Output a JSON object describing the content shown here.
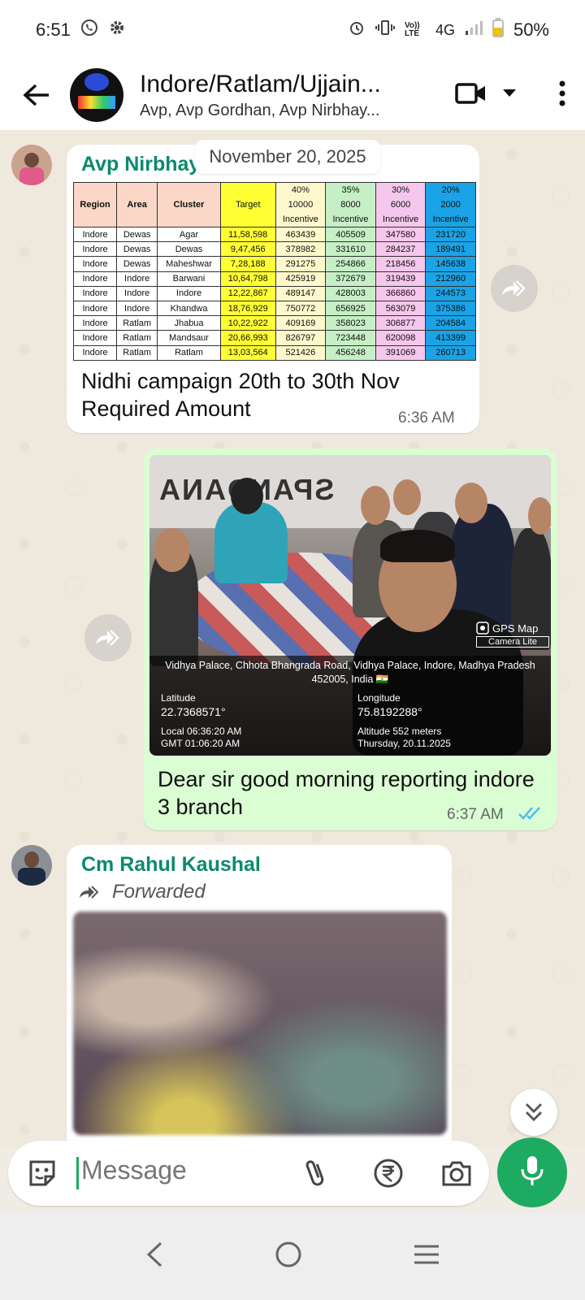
{
  "status_bar": {
    "time": "6:51",
    "network": "4G",
    "battery": "50%",
    "volte": "Vo)) LTE"
  },
  "header": {
    "title": "Indore/Ratlam/Ujjain...",
    "members": "Avp, Avp Gordhan, Avp Nirbhay..."
  },
  "date_chip": "November 20, 2025",
  "messages": {
    "m1": {
      "sender": "Avp Nirbhay Sir",
      "table": {
        "headers": [
          "Region",
          "Area",
          "Cluster",
          "Target",
          "40%\n10000\nIncentive",
          "35%\n8000\nIncentive",
          "30%\n6000\nIncentive",
          "20%\n2000\nIncentive"
        ],
        "rows": [
          [
            "Indore",
            "Dewas",
            "Agar",
            "11,58,598",
            "463439",
            "405509",
            "347580",
            "231720"
          ],
          [
            "Indore",
            "Dewas",
            "Dewas",
            "9,47,456",
            "378982",
            "331610",
            "284237",
            "189491"
          ],
          [
            "Indore",
            "Dewas",
            "Maheshwar",
            "7,28,188",
            "291275",
            "254866",
            "218456",
            "145638"
          ],
          [
            "Indore",
            "Indore",
            "Barwani",
            "10,64,798",
            "425919",
            "372679",
            "319439",
            "212960"
          ],
          [
            "Indore",
            "Indore",
            "Indore",
            "12,22,867",
            "489147",
            "428003",
            "366860",
            "244573"
          ],
          [
            "Indore",
            "Indore",
            "Khandwa",
            "18,76,929",
            "750772",
            "656925",
            "563079",
            "375386"
          ],
          [
            "Indore",
            "Ratlam",
            "Jhabua",
            "10,22,922",
            "409169",
            "358023",
            "306877",
            "204584"
          ],
          [
            "Indore",
            "Ratlam",
            "Mandsaur",
            "20,66,993",
            "826797",
            "723448",
            "620098",
            "413399"
          ],
          [
            "Indore",
            "Ratlam",
            "Ratlam",
            "13,03,564",
            "521426",
            "456248",
            "391069",
            "260713"
          ]
        ]
      },
      "text": "Nidhi campaign 20th to 30th Nov Required Amount",
      "time": "6:36 AM"
    },
    "m2": {
      "photo_wall_text": "SPANDANA",
      "gps_brand": "GPS Map",
      "gps_brand_sub": "Camera Lite",
      "address": "Vidhya Palace, Chhota Bhangrada Road, Vidhya Palace, Indore, Madhya Pradesh 452005, India 🇮🇳",
      "latitude_label": "Latitude",
      "latitude": "22.7368571°",
      "longitude_label": "Longitude",
      "longitude": "75.8192288°",
      "local_time": "Local 06:36:20 AM",
      "gmt_time": "GMT 01:06:20 AM",
      "altitude": "Altitude 552 meters",
      "day_date": "Thursday, 20.11.2025",
      "text": "Dear sir good morning reporting indore 3 branch",
      "time": "6:37 AM"
    },
    "m3": {
      "sender": "Cm Rahul Kaushal",
      "forwarded": "Forwarded"
    }
  },
  "composer": {
    "placeholder": "Message"
  },
  "colors": {
    "accent": "#1daa61",
    "sender": "#0b8a6e",
    "outgoing_bubble": "#dafdd3",
    "read_ticks": "#53bdeb"
  }
}
